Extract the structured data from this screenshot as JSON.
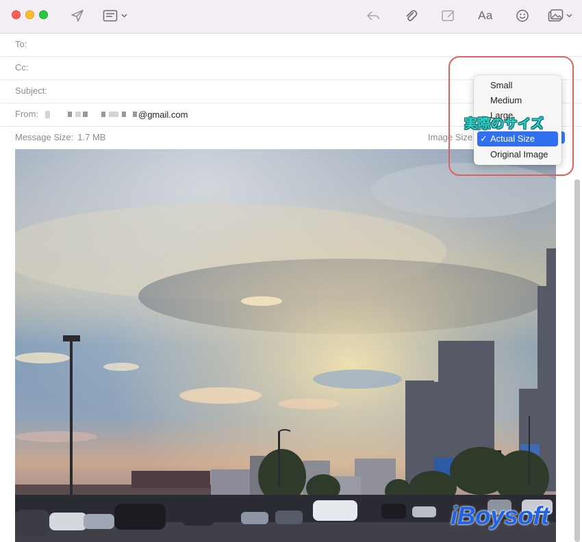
{
  "toolbar": {
    "buttons": [
      {
        "name": "send-icon"
      },
      {
        "name": "header-fields-icon"
      },
      {
        "name": "reply-icon"
      },
      {
        "name": "attachment-icon"
      },
      {
        "name": "markup-icon"
      },
      {
        "name": "format-fonts"
      },
      {
        "name": "emoji-icon"
      },
      {
        "name": "photo-browser-icon"
      }
    ],
    "format_label": "Aa"
  },
  "fields": {
    "to_label": "To:",
    "cc_label": "Cc:",
    "subject_label": "Subject:",
    "from_label": "From:",
    "from_value": "@gmail.com",
    "message_size_label": "Message Size:",
    "message_size_value": "1.7 MB",
    "image_size_label": "Image Size"
  },
  "image_size_menu": {
    "options": [
      "Small",
      "Medium",
      "Large",
      "Actual Size",
      "Original Image"
    ],
    "selected": "Actual Size",
    "check": "✓"
  },
  "annotation": {
    "callout_text": "実際のサイズ",
    "callout_color": "#e0615a",
    "text_color": "#2fd0c6"
  },
  "watermark": "iBoysoft",
  "colors": {
    "accent": "#2f6ff0",
    "titlebar": "#f3eef3"
  }
}
